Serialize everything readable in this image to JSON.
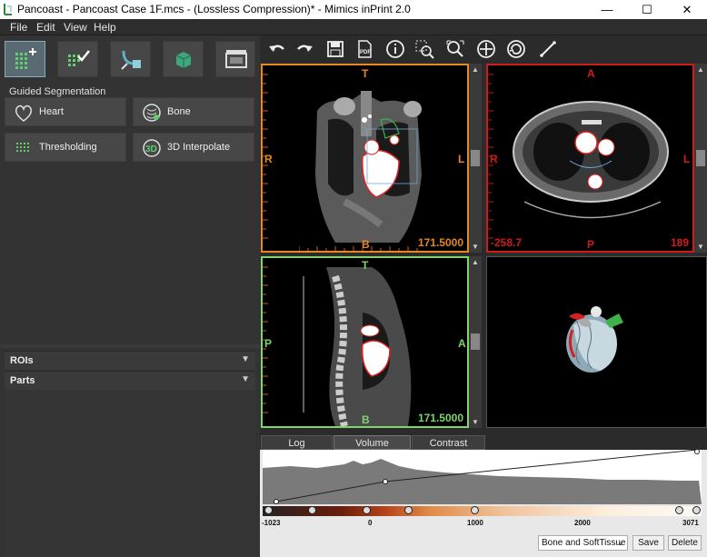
{
  "window": {
    "title": "Pancoast - Pancoast Case 1F.mcs -  (Lossless Compression)* - Mimics inPrint 2.0",
    "min_glyph": "—",
    "max_glyph": "☐",
    "close_glyph": "✕"
  },
  "menu": [
    "File",
    "Edit",
    "View",
    "Help"
  ],
  "left_panel": {
    "mode_buttons": [
      "segment-icon",
      "mask-edit-icon",
      "vessel-icon",
      "3d-box-icon",
      "printer-icon"
    ],
    "guided_label": "Guided Segmentation",
    "tools": [
      "Heart",
      "Bone",
      "Thresholding",
      "3D Interpolate"
    ],
    "accordions": [
      "ROIs",
      "Parts"
    ]
  },
  "toolbar": [
    "undo-icon",
    "redo-icon",
    "save-icon",
    "pdf-icon",
    "info-icon",
    "zoom-region-icon",
    "zoom-icon",
    "pan-icon",
    "rotate-icon",
    "measure-icon"
  ],
  "views": {
    "coronal": {
      "top": "T",
      "bottom": "B",
      "left": "R",
      "right": "L",
      "value": "171.5000",
      "border_color": "#e8871e"
    },
    "axial": {
      "top": "A",
      "bottom": "P",
      "left": "R",
      "right": "L",
      "value_left": "-258.7",
      "value_right": "189",
      "border_color": "#d11a1a"
    },
    "sagittal": {
      "top": "T",
      "bottom": "B",
      "left": "P",
      "right": "A",
      "value": "171.5000",
      "border_color": "#7fd46a"
    }
  },
  "tabs": [
    "Log",
    "Volume Rendering",
    "Contrast"
  ],
  "active_tab": "Volume Rendering",
  "volume_rendering": {
    "ticks": [
      "-1023",
      "0",
      "1000",
      "2000",
      "3071"
    ],
    "preset": "Bone and SoftTissue",
    "save_label": "Save",
    "delete_label": "Delete"
  }
}
